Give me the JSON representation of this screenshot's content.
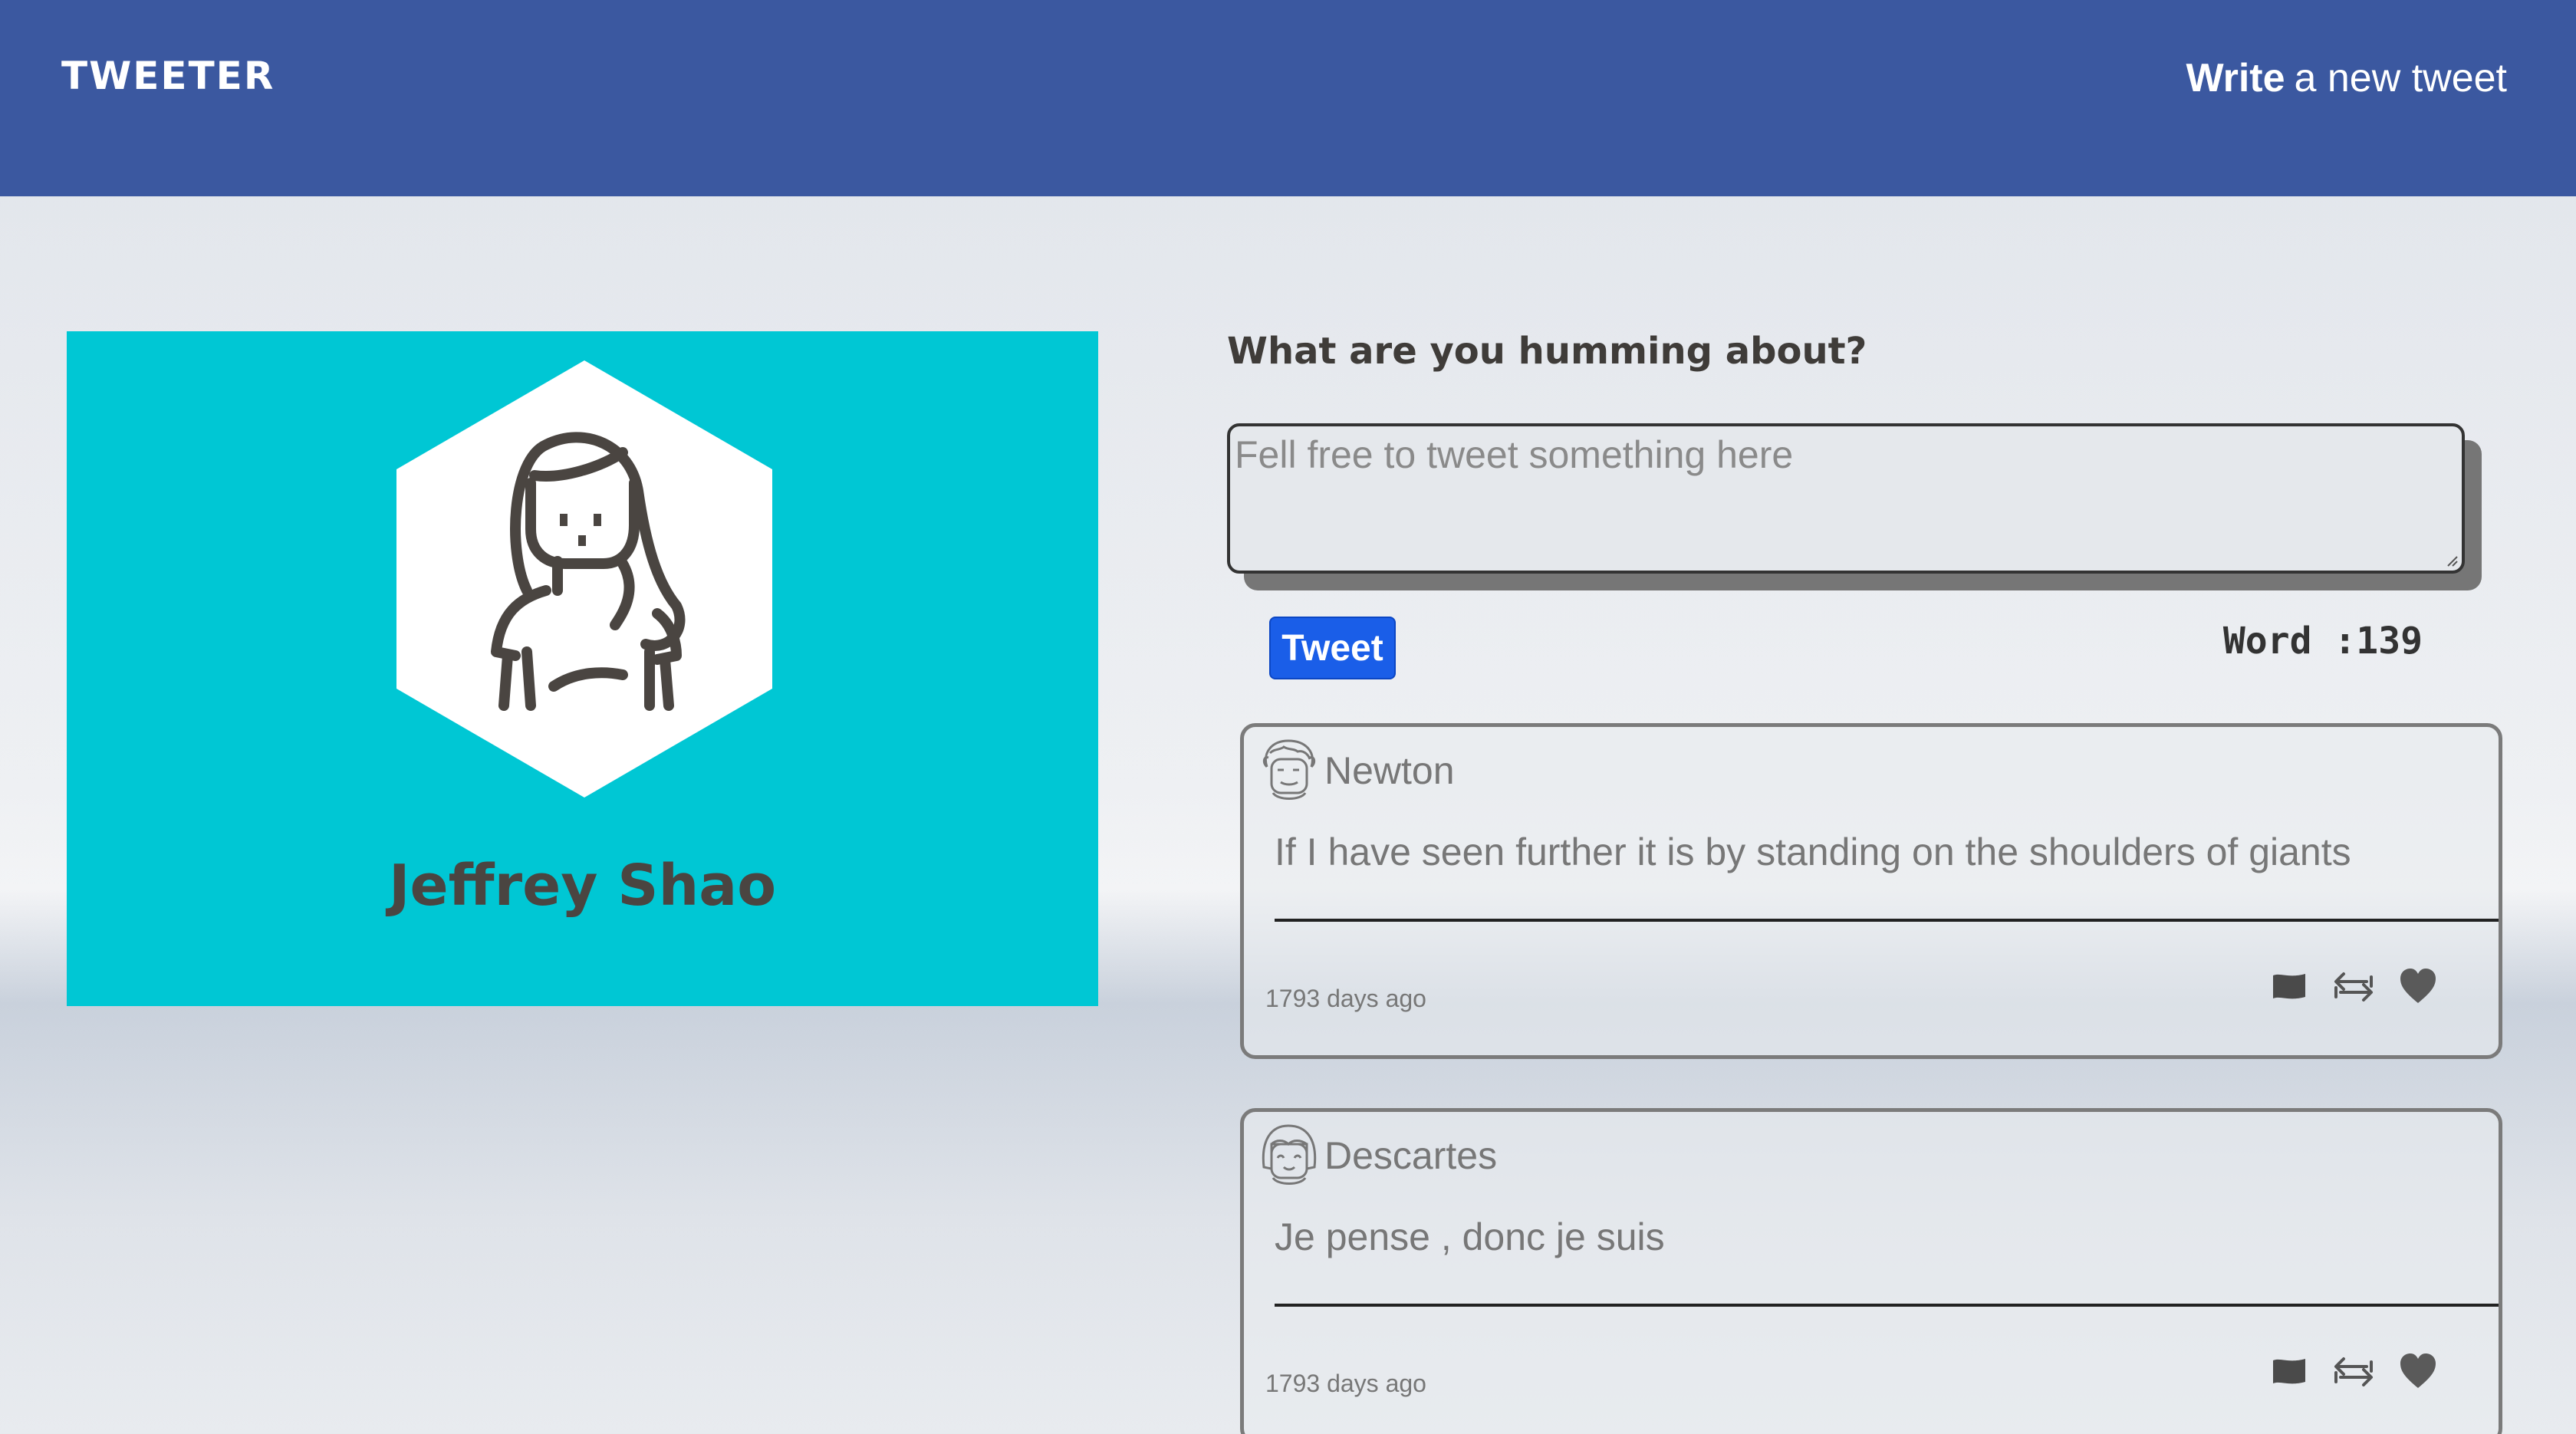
{
  "header": {
    "brand": "TWEETER",
    "write_bold": "Write",
    "write_rest": "a new tweet"
  },
  "profile": {
    "name": "Jeffrey Shao"
  },
  "compose": {
    "title": "What are you humming about?",
    "placeholder": "Fell free to tweet something here",
    "button": "Tweet",
    "counter": "Word :139"
  },
  "tweets": [
    {
      "author": "Newton",
      "text": "If I have seen further it is by standing on the shoulders of giants",
      "time": "1793 days ago",
      "avatar_icon": "curly-hair-avatar-icon"
    },
    {
      "author": "Descartes",
      "text": "Je pense , donc je suis",
      "time": "1793 days ago",
      "avatar_icon": "bob-hair-avatar-icon"
    }
  ],
  "icons": [
    "flag-icon",
    "retweet-icon",
    "heart-icon"
  ],
  "colors": {
    "nav": "#3b58a0",
    "profile_bg": "#00c7d4",
    "tweet_button": "#1a5ee8"
  }
}
